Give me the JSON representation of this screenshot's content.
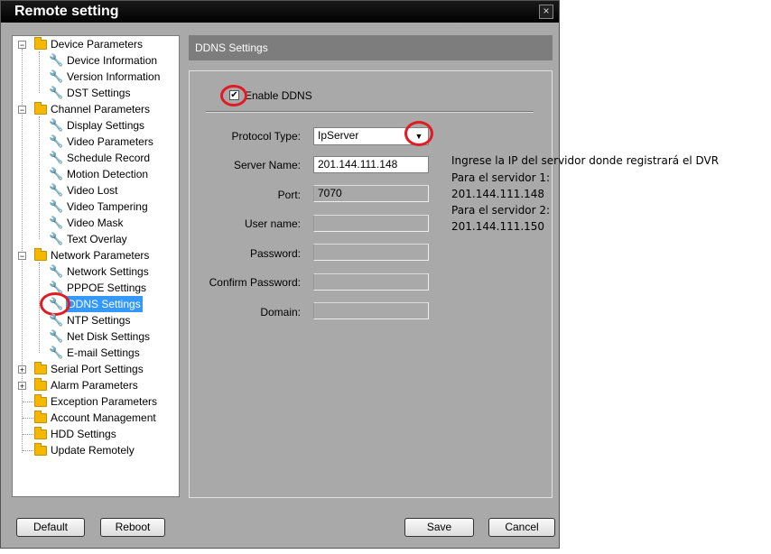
{
  "window": {
    "title": "Remote setting",
    "close_label": "×"
  },
  "tree": {
    "items": [
      {
        "label": "Device Parameters"
      },
      {
        "label": "Device Information"
      },
      {
        "label": "Version Information"
      },
      {
        "label": "DST Settings"
      },
      {
        "label": "Channel Parameters"
      },
      {
        "label": "Display Settings"
      },
      {
        "label": "Video Parameters"
      },
      {
        "label": "Schedule Record"
      },
      {
        "label": "Motion Detection"
      },
      {
        "label": "Video Lost"
      },
      {
        "label": "Video Tampering"
      },
      {
        "label": "Video Mask"
      },
      {
        "label": "Text Overlay"
      },
      {
        "label": "Network Parameters"
      },
      {
        "label": "Network Settings"
      },
      {
        "label": "PPPOE Settings"
      },
      {
        "label": "DDNS Settings",
        "selected": true
      },
      {
        "label": "NTP Settings"
      },
      {
        "label": "Net Disk Settings"
      },
      {
        "label": "E-mail Settings"
      },
      {
        "label": "Serial Port Settings"
      },
      {
        "label": "Alarm Parameters"
      },
      {
        "label": "Exception Parameters"
      },
      {
        "label": "Account Management"
      },
      {
        "label": "HDD Settings"
      },
      {
        "label": "Update Remotely"
      }
    ],
    "expander_minus": "−",
    "expander_plus": "+"
  },
  "panel": {
    "header": "DDNS Settings",
    "enable_label": "Enable DDNS",
    "enable_checked": true,
    "check_mark": "✔",
    "protocol_label": "Protocol Type:",
    "protocol_value": "IpServer",
    "dropdown_arrow": "▼",
    "server_label": "Server Name:",
    "server_value": "201.144.111.148",
    "port_label": "Port:",
    "port_value": "7070",
    "user_label": "User name:",
    "user_value": "",
    "password_label": "Password:",
    "password_value": "",
    "confirm_label": "Confirm Password:",
    "confirm_value": "",
    "domain_label": "Domain:",
    "domain_value": ""
  },
  "buttons": {
    "default": "Default",
    "reboot": "Reboot",
    "save": "Save",
    "cancel": "Cancel"
  },
  "note": {
    "line1": "Ingrese la IP del servidor donde registrará el DVR",
    "line2": "Para el servidor 1:",
    "line3": "201.144.111.148",
    "line4": "Para el servidor 2:",
    "line5": "201.144.111.150"
  },
  "colors": {
    "annotation_ring": "#e01b24",
    "selection": "#3399ff",
    "titlebar": "#000000"
  }
}
